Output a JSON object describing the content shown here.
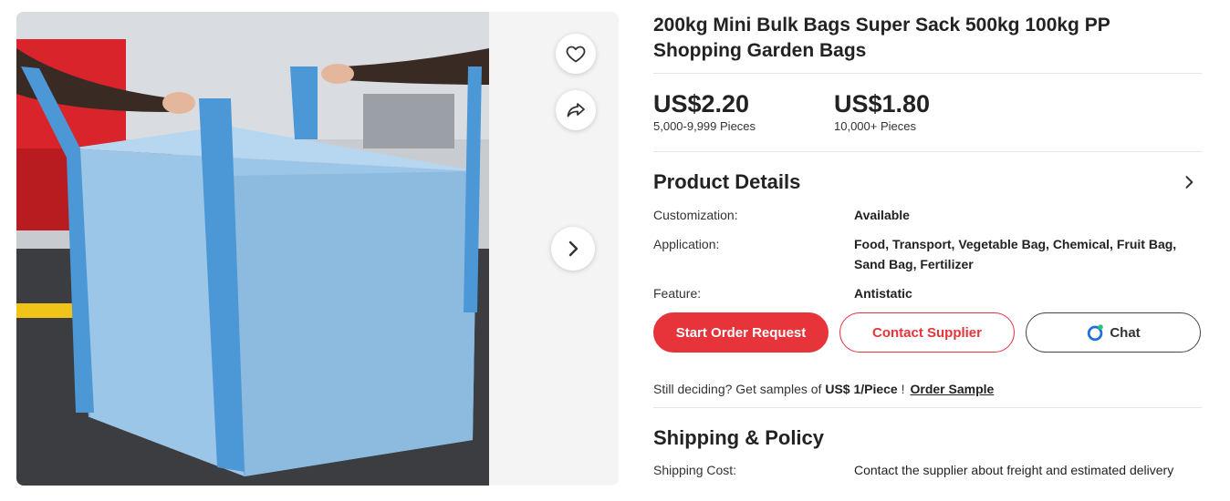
{
  "product": {
    "title": "200kg Mini Bulk Bags Super Sack 500kg 100kg PP Shopping Garden Bags"
  },
  "gallery": {
    "favorite_icon": "heart-icon",
    "share_icon": "share-arrow-icon",
    "next_icon": "chevron-right-icon"
  },
  "prices": [
    {
      "value": "US$2.20",
      "range": "5,000-9,999 Pieces"
    },
    {
      "value": "US$1.80",
      "range": "10,000+ Pieces"
    }
  ],
  "details": {
    "title": "Product Details",
    "rows": [
      {
        "key": "Customization:",
        "value": "Available"
      },
      {
        "key": "Application:",
        "value": "Food, Transport, Vegetable Bag, Chemical, Fruit Bag, Sand Bag, Fertilizer"
      },
      {
        "key": "Feature:",
        "value": "Antistatic"
      }
    ]
  },
  "actions": {
    "start_order": "Start Order Request",
    "contact_supplier": "Contact Supplier",
    "chat": "Chat"
  },
  "sample": {
    "prefix": "Still deciding? Get samples of ",
    "price": "US$ 1/Piece",
    "suffix": " !",
    "link": "Order Sample"
  },
  "shipping": {
    "title": "Shipping & Policy",
    "cost_label": "Shipping Cost:",
    "cost_value": "Contact the supplier about freight and estimated delivery"
  },
  "colors": {
    "accent": "#e6343a",
    "bag_blue": "#9cc6e8",
    "strap_blue": "#4c97d6"
  }
}
